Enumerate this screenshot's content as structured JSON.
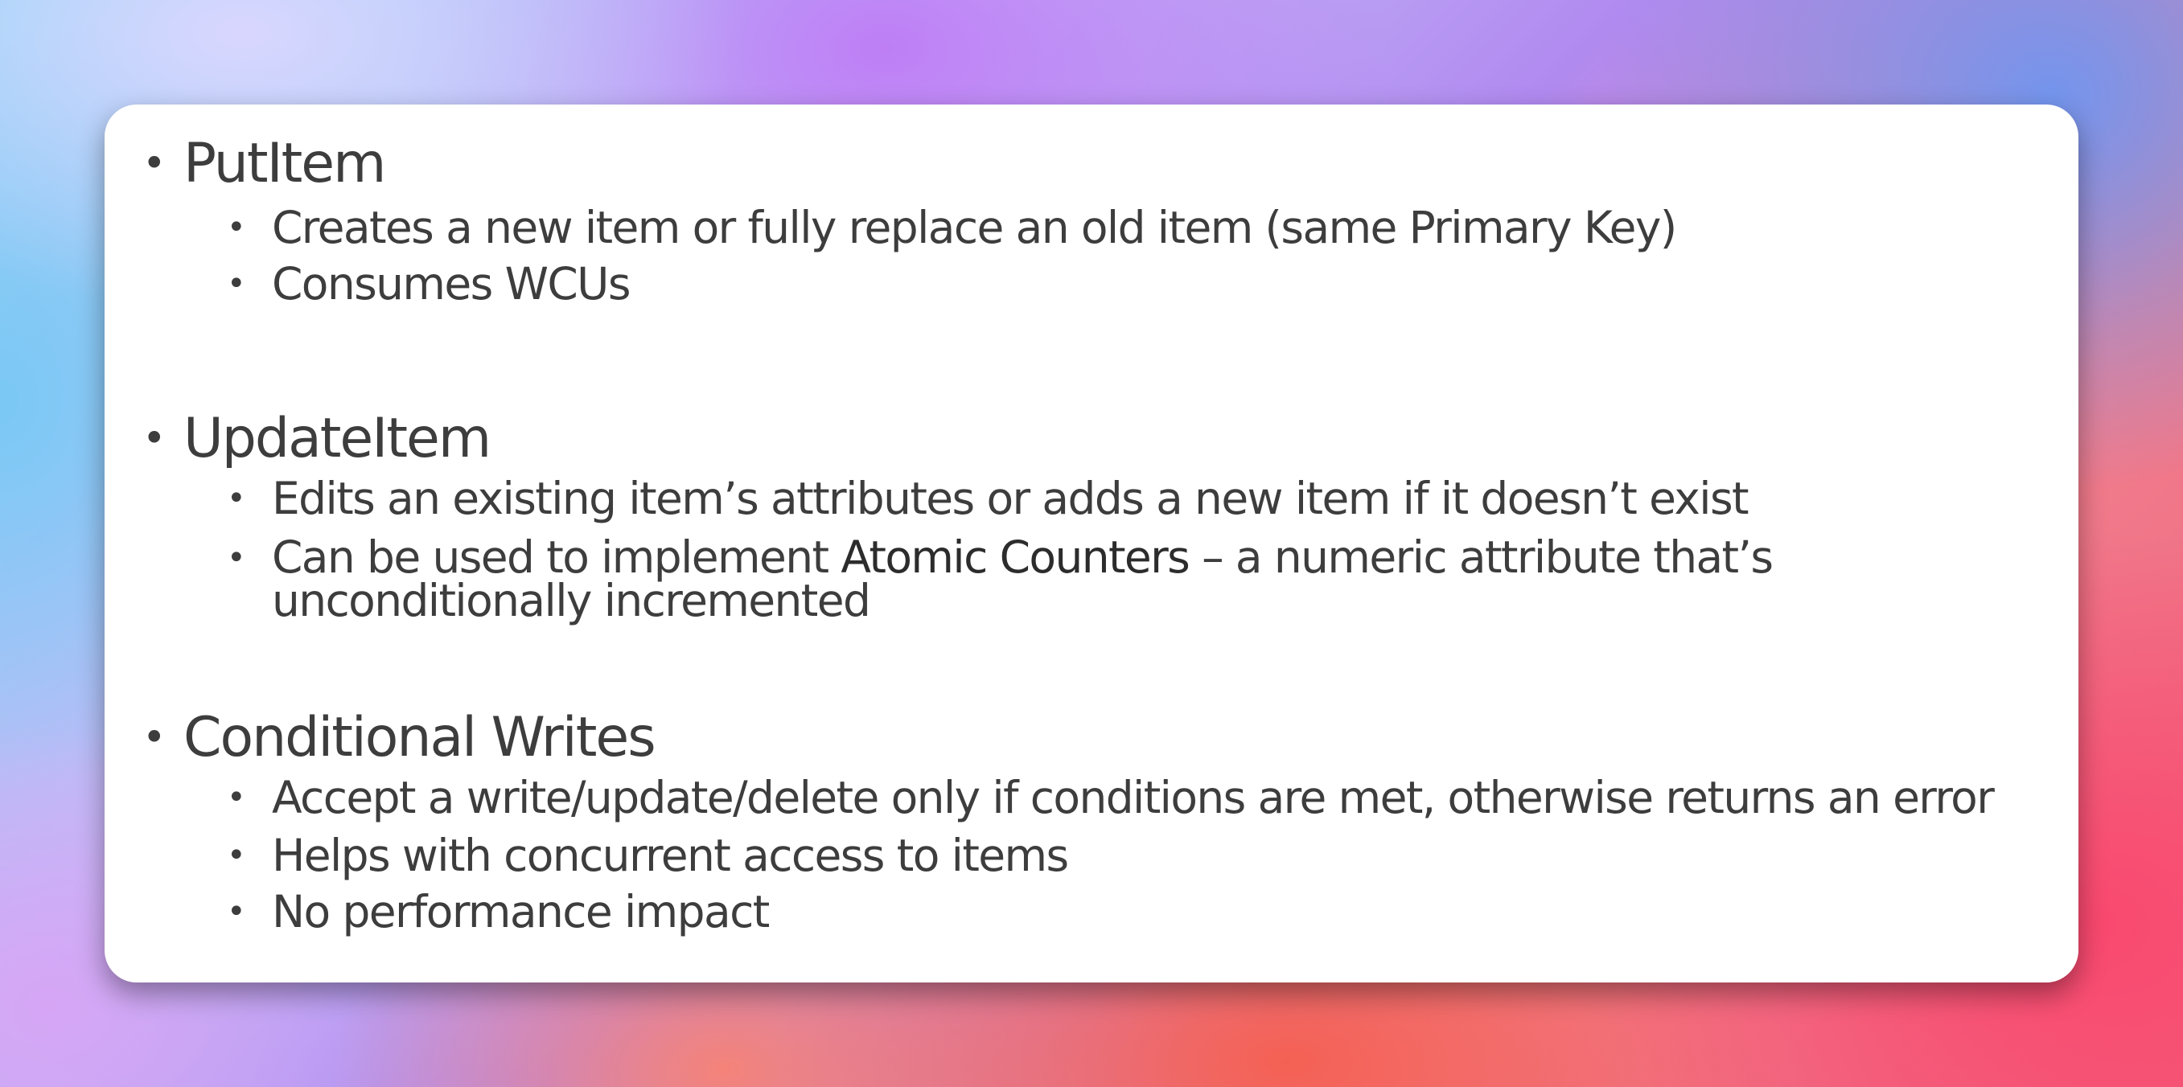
{
  "slide": {
    "sections": [
      {
        "heading": "PutItem",
        "points": [
          "Creates a new item or fully replace an old item (same Primary Key)",
          "Consumes WCUs"
        ]
      },
      {
        "heading": "UpdateItem",
        "points": [
          "Edits an existing item’s attributes or adds a new item if it doesn’t exist"
        ],
        "point_2": {
          "before": "Can be used to implement ",
          "emphasis": "Atomic Counters",
          "after": " – a numeric attribute that’s unconditionally incremented"
        }
      },
      {
        "heading": "Conditional Writes",
        "points": [
          "Accept a write/update/delete only if conditions are met, otherwise returns an error",
          "Helps with concurrent access to items",
          "No performance impact"
        ]
      }
    ]
  }
}
